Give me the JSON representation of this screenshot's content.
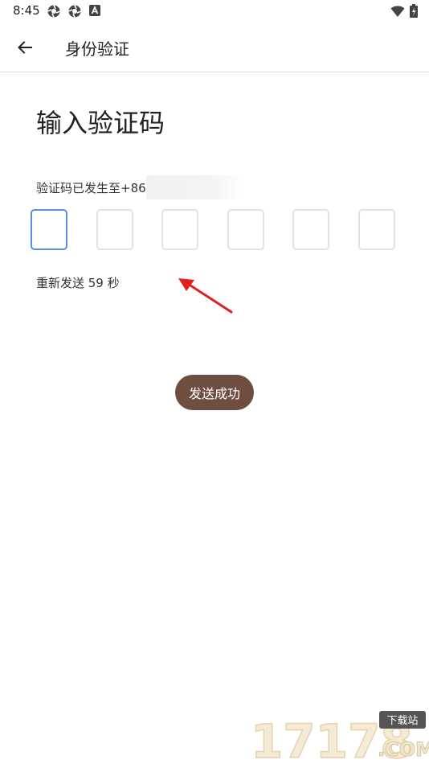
{
  "status_bar": {
    "time": "8:45",
    "left_icons": [
      "app-icon",
      "app-icon",
      "notification-a-icon"
    ],
    "right_icons": [
      "wifi-icon",
      "battery-charging-icon"
    ]
  },
  "app_bar": {
    "back_icon": "arrow-left-icon",
    "title": "身份验证"
  },
  "main": {
    "heading": "输入验证码",
    "sent_to_prefix": "验证码已发生至+86",
    "code_boxes": [
      "",
      "",
      "",
      "",
      "",
      ""
    ],
    "active_box_index": 0,
    "resend_text": "重新发送 59 秒"
  },
  "toast": {
    "text": "发送成功",
    "background": "#6f4e40"
  },
  "colors": {
    "active_border": "#5b8de0",
    "box_border": "#e2e2e2",
    "annotation_arrow": "#e02020"
  },
  "watermark": {
    "text": "17178",
    "badge": "下载站",
    "suffix": ".COM"
  }
}
